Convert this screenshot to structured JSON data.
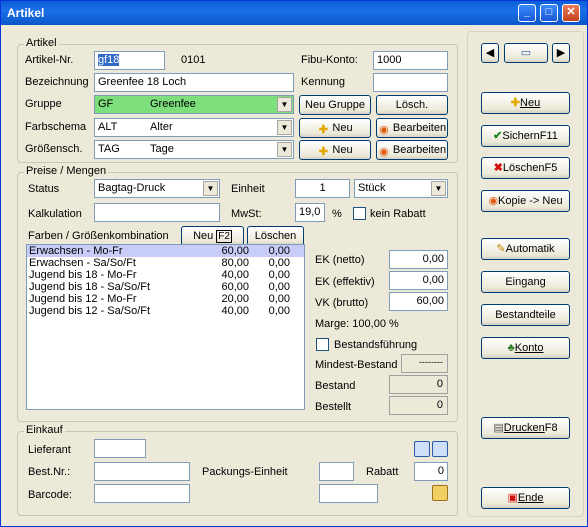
{
  "window": {
    "title": "Artikel",
    "minimize": "_",
    "maximize": "□",
    "close": "✕"
  },
  "artikel": {
    "legend": "Artikel",
    "nr_label": "Artikel-Nr.",
    "nr_value": "gf18",
    "nr_suffix": "0101",
    "fibu_label": "Fibu-Konto:",
    "fibu_value": "1000",
    "bez_label": "Bezeichnung",
    "bez_value": "Greenfee 18 Loch",
    "kennung_label": "Kennung",
    "kennung_value": "",
    "gruppe_label": "Gruppe",
    "gruppe_code": "GF",
    "gruppe_name": "Greenfee",
    "neu_gruppe": "Neu Gruppe",
    "loesch": "Lösch.",
    "farb_label": "Farbschema",
    "farb_code": "ALT",
    "farb_name": "Alter",
    "groessen_label": "Größensch.",
    "groessen_code": "TAG",
    "groessen_name": "Tage",
    "neu": "Neu",
    "bearbeiten": "Bearbeiten"
  },
  "preise": {
    "legend": "Preise / Mengen",
    "status_label": "Status",
    "status_value": "Bagtag-Druck",
    "einheit_label": "Einheit",
    "einheit_value": "1",
    "einheit_unit": "Stück",
    "kalk_label": "Kalkulation",
    "kalk_value": "",
    "mwst_label": "MwSt:",
    "mwst_value": "19,0",
    "mwst_pct": "%",
    "kein_rabatt": "kein Rabatt",
    "farben_label": "Farben / Größenkombination",
    "neu_btn": "Neu",
    "neu_key": "F2",
    "loeschen_btn": "Löschen",
    "rows": [
      {
        "name": "Erwachsen - Mo-Fr",
        "price": "60,00",
        "extra": "0,00"
      },
      {
        "name": "Erwachsen - Sa/So/Ft",
        "price": "80,00",
        "extra": "0,00"
      },
      {
        "name": "Jugend bis 18 - Mo-Fr",
        "price": "40,00",
        "extra": "0,00"
      },
      {
        "name": "Jugend bis 18 - Sa/So/Ft",
        "price": "60,00",
        "extra": "0,00"
      },
      {
        "name": "Jugend bis 12 - Mo-Fr",
        "price": "20,00",
        "extra": "0,00"
      },
      {
        "name": "Jugend bis 12 - Sa/So/Ft",
        "price": "40,00",
        "extra": "0,00"
      }
    ],
    "ek_netto_label": "EK (netto)",
    "ek_netto": "0,00",
    "ek_eff_label": "EK (effektiv)",
    "ek_eff": "0,00",
    "vk_label": "VK (brutto)",
    "vk": "60,00",
    "marge": "Marge: 100,00 %",
    "bestandsfuehrung": "Bestandsführung",
    "mindest_label": "Mindest-Bestand",
    "mindest_value": "--------",
    "bestand_label": "Bestand",
    "bestand_value": "0",
    "bestellt_label": "Bestellt",
    "bestellt_value": "0"
  },
  "einkauf": {
    "legend": "Einkauf",
    "lieferant_label": "Lieferant",
    "lieferant_value": "",
    "bestnr_label": "Best.Nr.:",
    "bestnr_value": "",
    "pack_label": "Packungs-Einheit",
    "pack_value": "",
    "rabatt_label": "Rabatt",
    "rabatt_value": "0",
    "barcode_label": "Barcode:",
    "barcode_value": "",
    "barcode2_value": ""
  },
  "side": {
    "neu": "Neu",
    "sichern": "Sichern",
    "sichern_key": "F11",
    "loeschen": "Löschen",
    "loeschen_key": "F5",
    "kopie": "Kopie -> Neu",
    "automatik": "Automatik",
    "eingang": "Eingang",
    "bestandteile": "Bestandteile",
    "konto": "Konto",
    "drucken": "Drucken",
    "drucken_key": "F8",
    "ende": "Ende"
  }
}
